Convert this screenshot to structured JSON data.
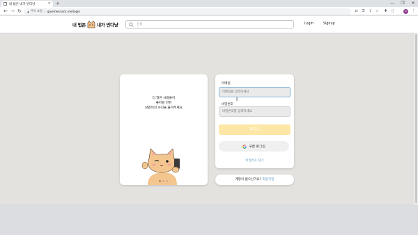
{
  "browser": {
    "tab_title": "내 법은 내가 번다냥",
    "new_tab": "+",
    "security_label": "주의 요함",
    "url": "givemesnack.me/login",
    "window_controls": [
      "—",
      "❐",
      "✕"
    ]
  },
  "header": {
    "logo_left": "내 법은",
    "logo_right": "내가 번다냥",
    "search_placeholder": "검색",
    "nav_login": "Login",
    "nav_signup": "Signup"
  },
  "promo": {
    "line1": "더 많은 사람들이",
    "line2": "좋아할 만한",
    "line3": "냥밥이의 사진을 올려주세요",
    "slides": 3,
    "active_slide": 0
  },
  "login": {
    "email_label": "이메일",
    "email_placeholder": "이메일을 입력하세요",
    "password_label": "비밀번호",
    "password_placeholder": "비밀번호를 입력하세요",
    "login_button": "로그인",
    "google_button": "구글 로그인",
    "find_password": "비밀번호 찾기"
  },
  "signup": {
    "prompt": "계정이 없으신가요?",
    "link": "회원가입"
  },
  "colors": {
    "login_button": "#fde7a6",
    "link": "#5a94c0",
    "page_bg": "#e4e2df"
  }
}
